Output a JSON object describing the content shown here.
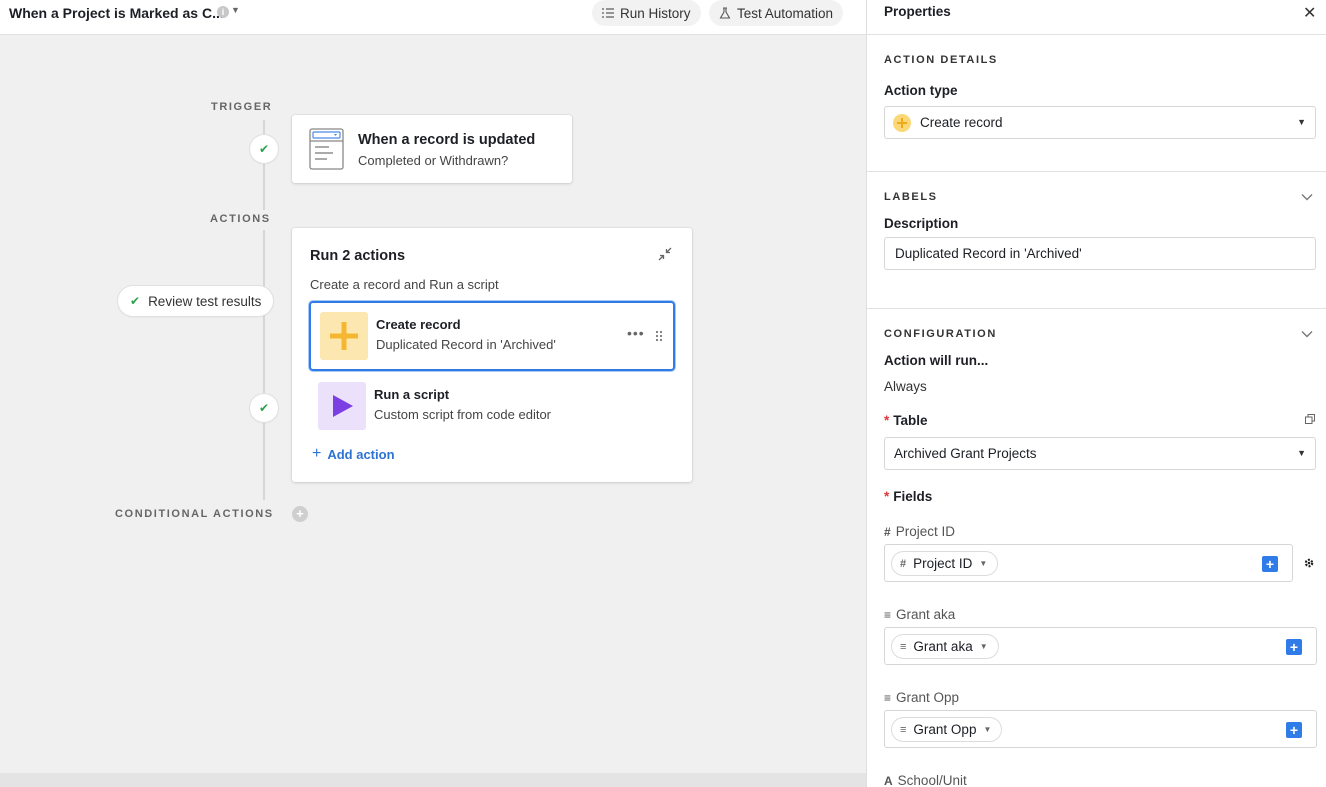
{
  "topbar": {
    "title": "When a Project is Marked as C...",
    "run_history": "Run History",
    "test_automation": "Test Automation"
  },
  "canvas": {
    "trigger_label": "TRIGGER",
    "actions_label": "ACTIONS",
    "conditional_label": "CONDITIONAL ACTIONS",
    "review_pill": "Review test results",
    "trigger": {
      "title": "When a record is updated",
      "subtitle": "Completed or Withdrawn?"
    },
    "actions_card": {
      "title": "Run 2 actions",
      "subtitle": "Create a record and Run a script",
      "items": [
        {
          "title": "Create record",
          "subtitle": "Duplicated Record in 'Archived'",
          "icon": "plus-icon",
          "color": "#f5b731"
        },
        {
          "title": "Run a script",
          "subtitle": "Custom script from code editor",
          "icon": "play-icon",
          "color": "#7b3fe4"
        }
      ],
      "add_action": "Add action"
    }
  },
  "panel": {
    "title": "Properties",
    "action_details": {
      "label": "ACTION DETAILS",
      "action_type_label": "Action type",
      "action_type_value": "Create record"
    },
    "labels": {
      "label": "LABELS",
      "description_label": "Description",
      "description_value": "Duplicated Record in 'Archived'"
    },
    "configuration": {
      "label": "CONFIGURATION",
      "run_label": "Action will run...",
      "run_value": "Always",
      "table_label": "Table",
      "table_value": "Archived Grant Projects",
      "fields_label": "Fields",
      "fields": [
        {
          "label": "Project ID",
          "token": "Project ID",
          "glyph": "#"
        },
        {
          "label": "Grant aka",
          "token": "Grant aka",
          "glyph": "≡"
        },
        {
          "label": "Grant Opp",
          "token": "Grant Opp",
          "glyph": "≡"
        },
        {
          "label": "School/Unit",
          "glyph": "A"
        }
      ]
    }
  },
  "colors": {
    "accent": "#2f7be7",
    "check": "#2aa24a",
    "required": "#e0353b",
    "create_icon_bg": "#fde7b0",
    "script_icon_bg": "#ebe1fb"
  }
}
